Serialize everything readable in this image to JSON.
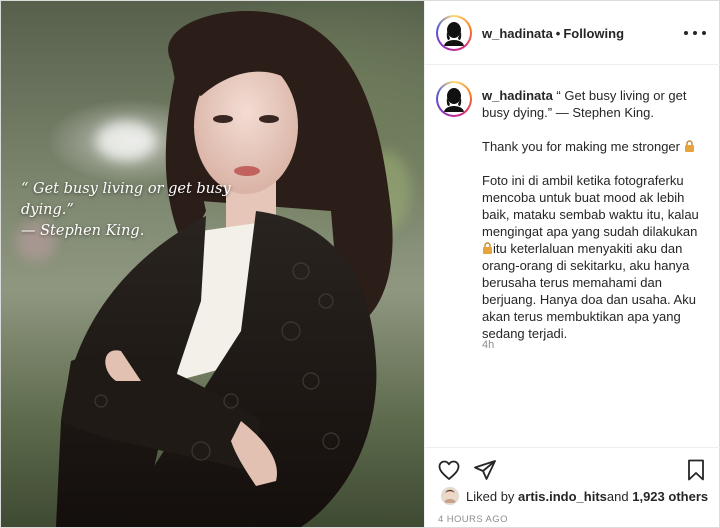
{
  "post": {
    "image_quote_line1": "“ Get busy living or get busy dying.”",
    "image_quote_line2": "— Stephen King."
  },
  "header": {
    "username": "w_hadinata",
    "separator": "•",
    "follow_status": "Following",
    "more_icon": "more-horizontal-icon"
  },
  "caption": {
    "username": "w_hadinata",
    "line1": " “ Get busy living or get busy dying.” — Stephen King.",
    "line2": "Thank you for making me stronger",
    "line3a": "Foto ini di ambil ketika fotograferku mencoba untuk buat mood ak lebih baik, mataku sembab waktu itu, kalau mengingat apa yang sudah dilakukan",
    "line3b": "itu keterlaluan menyakiti aku dan orang-orang di sekitarku, aku hanya berusaha terus memahami dan berjuang. Hanya doa dan usaha. Aku akan terus membuktikan apa yang sedang terjadi.",
    "lock_icon": "lock-icon",
    "time_ago": "4h"
  },
  "actions": {
    "like_icon": "heart-icon",
    "share_icon": "send-icon",
    "save_icon": "bookmark-icon"
  },
  "likes": {
    "prefix": "Liked by ",
    "liker": "artis.indo_hits",
    "middle": " and ",
    "count": "1,923 others"
  },
  "posted_ago": "4 HOURS AGO",
  "colors": {
    "text": "#262626",
    "secondary": "#8e8e8e",
    "border": "#dbdbdb",
    "lock": "#e8a33d"
  }
}
